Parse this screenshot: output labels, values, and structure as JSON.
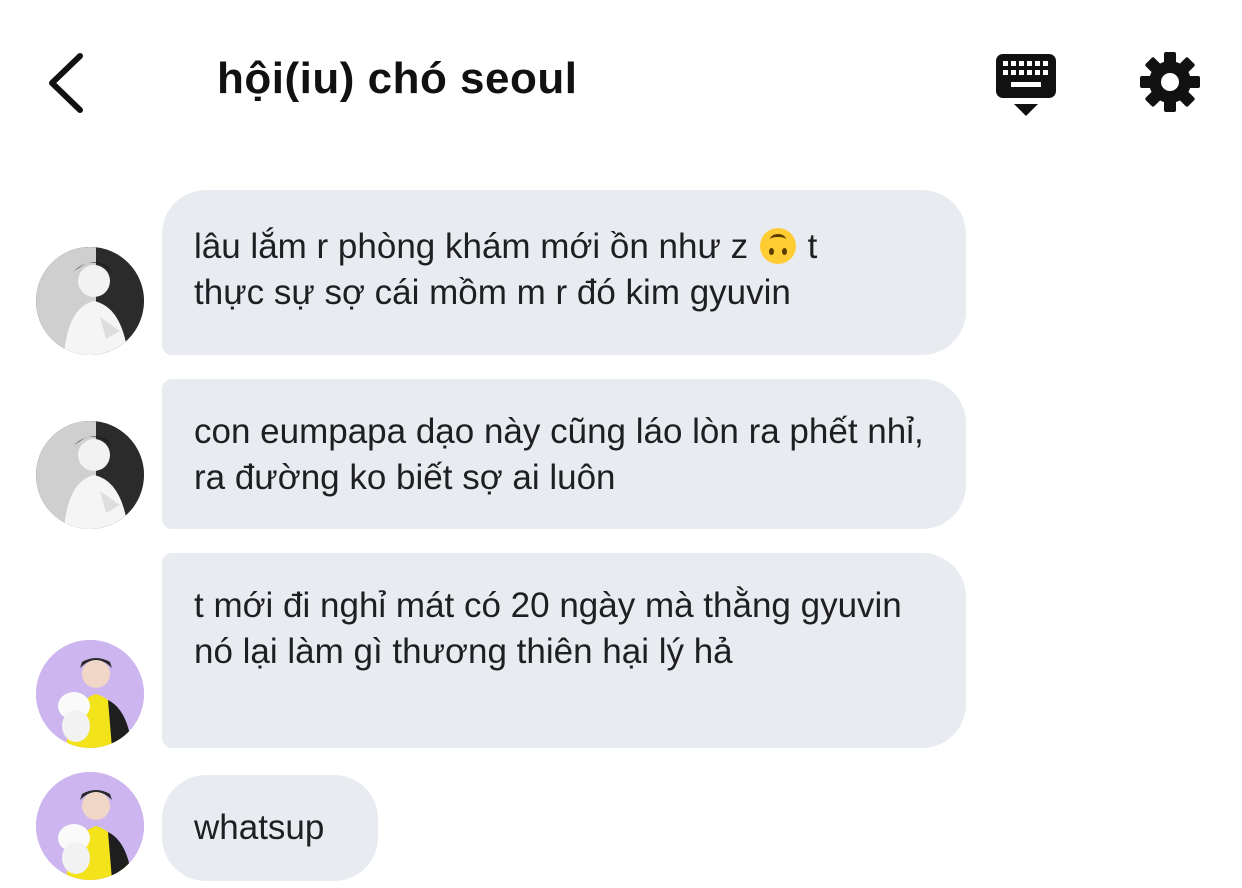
{
  "header": {
    "title": "hội(iu) chó seoul",
    "back_icon": "chevron-left-icon",
    "keyboard_icon": "keyboard-hide-icon",
    "settings_icon": "gear-icon"
  },
  "messages": [
    {
      "sender_avatar": "avatar-bw",
      "line1": "lâu lắm r phòng khám mới ồn như z",
      "emoji": "upside-down-face",
      "line1_tail": " t",
      "line2": "thực sự sợ cái mồm m r đó kim gyuvin"
    },
    {
      "sender_avatar": "avatar-bw",
      "text": "con eumpapa dạo này cũng láo lòn ra phết nhỉ, ra đường ko biết sợ ai luôn"
    },
    {
      "sender_avatar": "avatar-purple",
      "text": "t mới đi nghỉ mát có 20 ngày mà thằng gyuvin nó lại làm gì thương thiên hại lý hả"
    },
    {
      "sender_avatar": "avatar-purple",
      "text": "whatsup"
    }
  ],
  "colors": {
    "bubble": "#e8ebf0",
    "text": "#1f1f22",
    "background": "#ffffff"
  }
}
